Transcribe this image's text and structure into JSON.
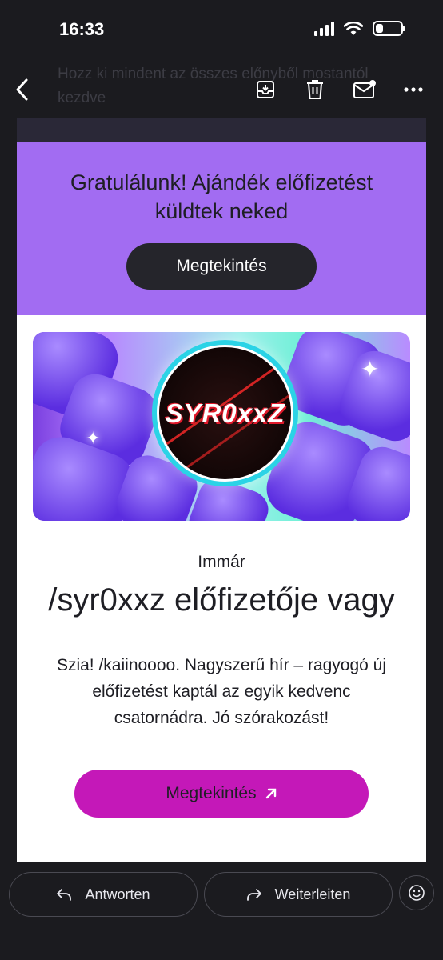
{
  "status_bar": {
    "time": "16:33",
    "battery_level": 0.3
  },
  "subject_ghost": "Hozz ki mindent az összes előnyből mostantól kezdve",
  "toolbar": {
    "back_icon": "chevron-left-icon",
    "archive_icon": "archive-icon",
    "delete_icon": "trash-icon",
    "mark_unread_icon": "mail-unread-icon",
    "more_icon": "more-horizontal-icon"
  },
  "email": {
    "hero": {
      "title": "Gratulálunk! Ajándék előfizetést küldtek neked",
      "button_label": "Megtekintés"
    },
    "banner": {
      "avatar_name": "SYR0xxZ"
    },
    "lead": "Immár",
    "channel_title": "/syr0xxz előfizetője vagy",
    "body": "Szia! /kaiinoooo. Nagyszerű hír – ragyogó új előfizetést kaptál az egyik kedvenc csatornádra. Jó szórakozást!",
    "cta_label": "Megtekintés",
    "colors": {
      "hero_bg": "#a26cf2",
      "cta_bg": "#c418b8",
      "dark_button": "#25252b"
    }
  },
  "bottom_bar": {
    "reply_label": "Antworten",
    "forward_label": "Weiterleiten",
    "emoji_icon": "smiley-icon"
  }
}
